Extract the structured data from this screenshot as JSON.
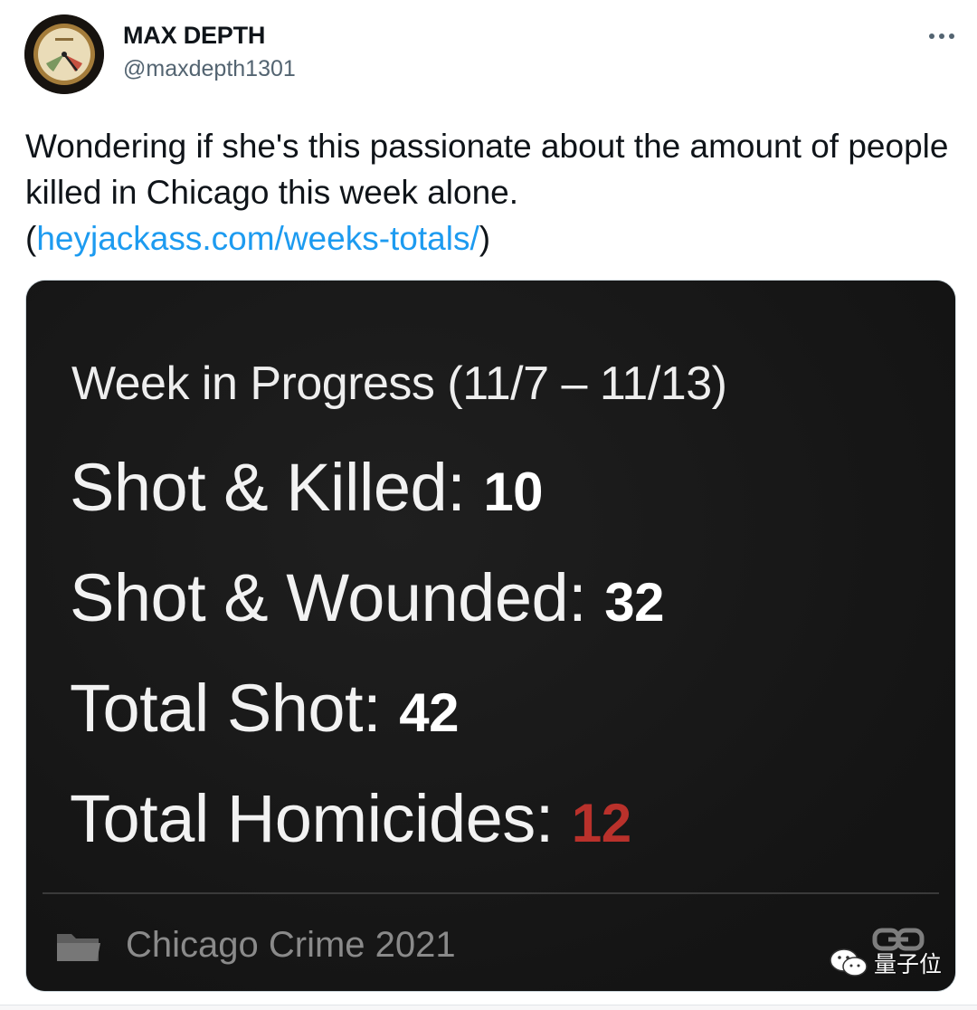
{
  "author": {
    "name": "MAX DEPTH",
    "handle": "@maxdepth1301",
    "avatar_icon": "depth-gauge-icon"
  },
  "menu": {
    "more_icon": "more-options-icon"
  },
  "tweet": {
    "text_before_link": "Wondering if she's this passionate about the amount of people killed in Chicago this week alone.",
    "paren_open": "(",
    "link_text": "heyjackass.com/weeks-totals/",
    "paren_close": ")",
    "link_color": "#1d9bf0"
  },
  "media": {
    "week_label": "Week in Progress (11/7 – 11/13)",
    "stats": [
      {
        "label": "Shot & Killed: ",
        "value": "10"
      },
      {
        "label": "Shot & Wounded: ",
        "value": "32"
      },
      {
        "label": "Total Shot: ",
        "value": "42"
      },
      {
        "label": "Total Homicides: ",
        "value": "12",
        "color": "#b9312b"
      }
    ],
    "category_icon": "folder-icon",
    "category": "Chicago Crime 2021",
    "link_icon": "chain-link-icon"
  },
  "watermark": {
    "icon": "wechat-icon",
    "text": "量子位"
  }
}
